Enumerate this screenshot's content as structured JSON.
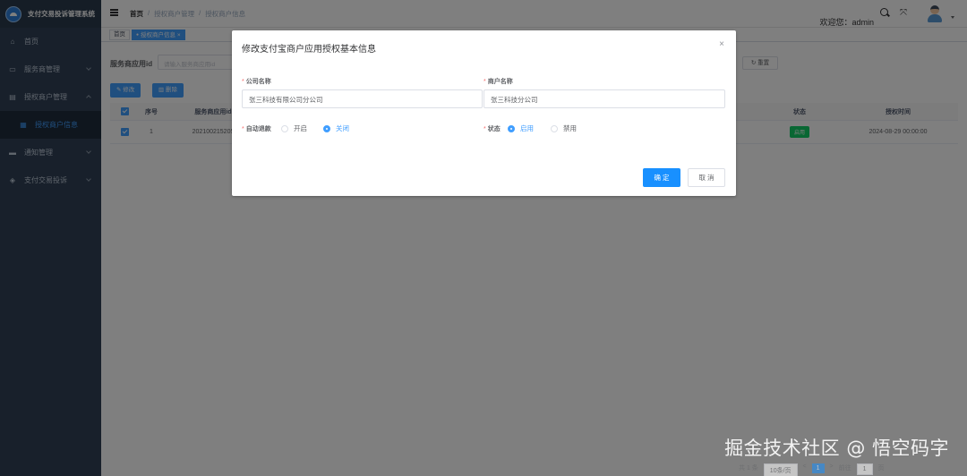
{
  "app": {
    "title": "支付交易投诉管理系统"
  },
  "sidebar": {
    "items": [
      {
        "label": "首页",
        "icon": "home-icon"
      },
      {
        "label": "服务商管理",
        "icon": "monitor-icon"
      },
      {
        "label": "授权商户管理",
        "icon": "document-icon"
      },
      {
        "label": "授权商户信息",
        "icon": "grid-icon"
      },
      {
        "label": "通知管理",
        "icon": "message-icon"
      },
      {
        "label": "支付交易投诉",
        "icon": "shield-icon"
      }
    ]
  },
  "header": {
    "breadcrumb": [
      "首页",
      "授权商户管理",
      "授权商户信息"
    ],
    "breadcrumb_sep": "/",
    "welcome": "欢迎您：admin"
  },
  "tags": {
    "home": "首页",
    "active": "授权商户信息"
  },
  "query": {
    "label": "服务商应用id",
    "placeholder": "请输入服务商应用id",
    "reset_label": "重置"
  },
  "toolbar": {
    "edit_label": "修改",
    "delete_label": "删除"
  },
  "table": {
    "headers": {
      "index": "序号",
      "appid": "服务商应用id",
      "status": "状态",
      "auth_time": "授权时间"
    },
    "rows": [
      {
        "index": "1",
        "appid": "202100215205",
        "status": "启用",
        "auth_time": "2024-08-29 00:00:00"
      }
    ]
  },
  "dialog": {
    "title": "修改支付宝商户应用授权基本信息",
    "company_label": "公司名称",
    "company_value": "张三科技有限公司分公司",
    "merchant_label": "商户名称",
    "merchant_value": "张三科技分公司",
    "refund_label": "自动退款",
    "refund_options": [
      "开启",
      "关闭"
    ],
    "refund_selected": "关闭",
    "status_label": "状态",
    "status_options": [
      "启用",
      "禁用"
    ],
    "status_selected": "启用",
    "ok_label": "确 定",
    "cancel_label": "取 消",
    "required_mark": "*"
  },
  "pager": {
    "total": "共 1 条",
    "page_size": "10条/页",
    "prev": "<",
    "current": "1",
    "next": ">",
    "goto_label": "前往",
    "goto_value": "1",
    "unit": "页"
  },
  "watermark": "掘金技术社区 @ 悟空码字",
  "colors": {
    "primary": "#1890ff",
    "sidebar": "#304156",
    "success": "#13ce66"
  }
}
